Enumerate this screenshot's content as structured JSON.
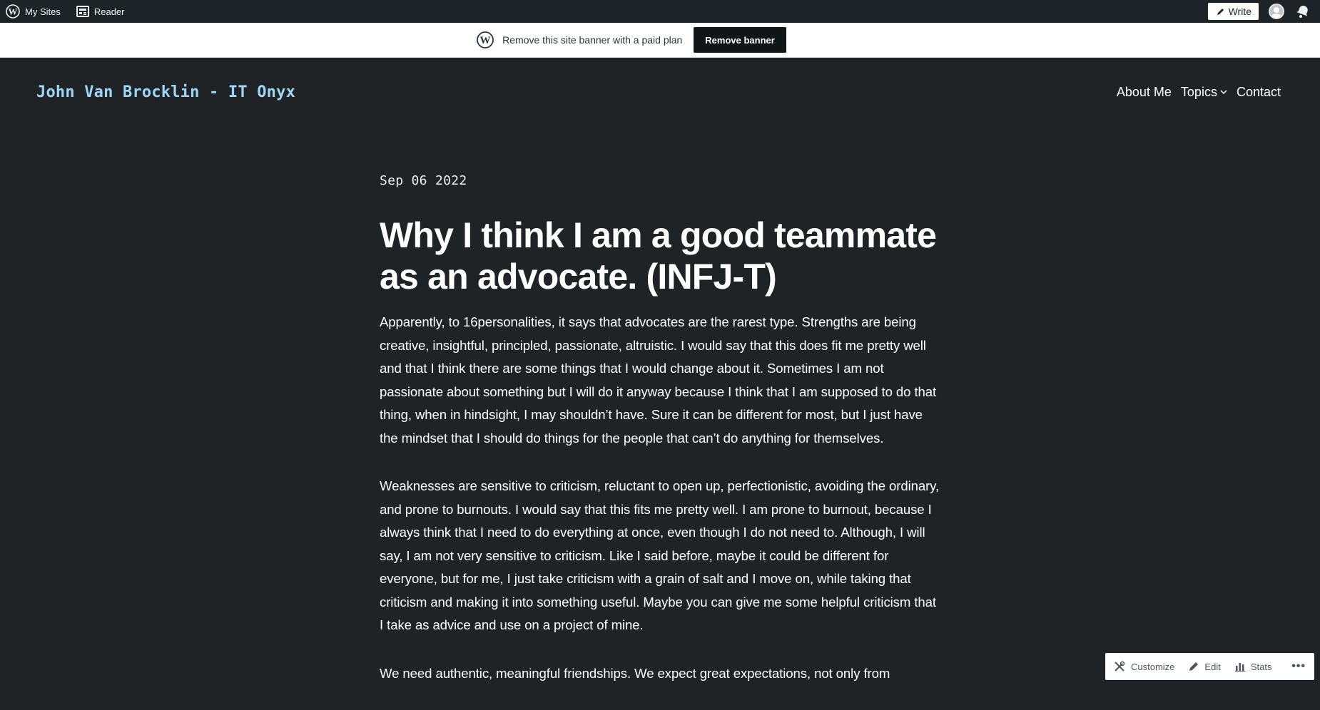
{
  "admin_bar": {
    "my_sites": "My Sites",
    "reader": "Reader",
    "write": "Write"
  },
  "banner": {
    "text": "Remove this site banner with a paid plan",
    "button": "Remove banner"
  },
  "site": {
    "title": "John Van Brocklin - IT Onyx",
    "nav": {
      "about": "About Me",
      "topics": "Topics",
      "contact": "Contact"
    }
  },
  "post": {
    "date": "Sep 06 2022",
    "title": "Why I think I am a good teammate as an advocate. (INFJ-T)",
    "paragraphs": [
      "Apparently, to 16personalities, it says that advocates are the rarest type. Strengths are being creative, insightful, principled, passionate, altruistic. I would say that this does fit me pretty well and that I think there are some things that I would change about it. Sometimes I am not passionate about something but I will do it anyway because I think that I am supposed to do that thing, when in hindsight, I may shouldn’t have. Sure it can be different for most, but I just have the mindset that I should do things for the people that can’t do anything for themselves.",
      "Weaknesses are sensitive to criticism, reluctant to open up, perfectionistic, avoiding the ordinary, and prone to burnouts. I would say that this fits me pretty well. I am prone to burnout, because I always think that I need to do everything at once, even though I do not need to. Although, I will say, I am not very sensitive to criticism. Like I said before, maybe it could be different for everyone, but for me, I just take criticism with a grain of salt and I move on, while taking that criticism and making it into something useful. Maybe you can give me some helpful criticism that I take as advice and use on a project of mine.",
      "We need authentic, meaningful friendships. We expect great expectations, not only from"
    ]
  },
  "float_bar": {
    "customize": "Customize",
    "edit": "Edit",
    "stats": "Stats",
    "more": "•••"
  }
}
